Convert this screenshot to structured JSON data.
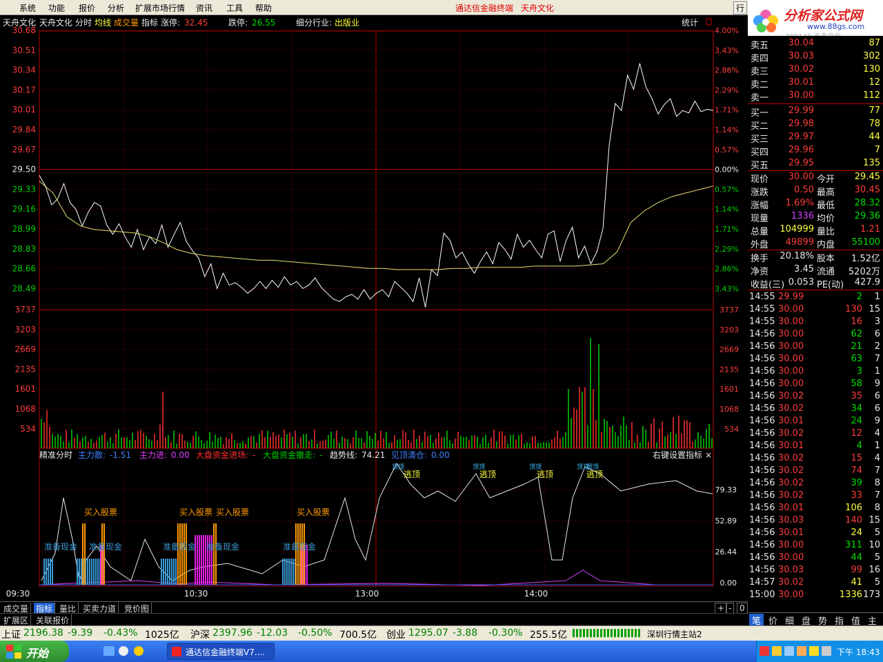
{
  "menu": {
    "items": [
      "系统",
      "功能",
      "报价",
      "分析",
      "扩展市场行情",
      "资讯",
      "工具",
      "帮助"
    ],
    "title1": "通达信金融终端",
    "title2": "天舟文化",
    "right_btn": "行"
  },
  "logo": {
    "text": "分析家公式网",
    "url": "www.88gs.com",
    "sub": "300148 天舟文化"
  },
  "chart_header": {
    "name": "天舟文化",
    "tabs": [
      "分时",
      "均线",
      "成交量",
      "指标"
    ],
    "zt_label": "涨停:",
    "zt_val": "32.45",
    "dt_label": "跌停:",
    "dt_val": "26.55",
    "ind_label": "细分行业:",
    "ind_val": "出版业",
    "stat": "统计"
  },
  "chart_data": [
    {
      "type": "line",
      "title": "天舟文化 分时",
      "prev_close": 29.5,
      "yticks_left": [
        "30.68",
        "30.51",
        "30.34",
        "30.17",
        "30.01",
        "29.84",
        "29.67",
        "29.50",
        "29.33",
        "29.16",
        "28.99",
        "28.83",
        "28.66",
        "28.49"
      ],
      "yticks_right": [
        "4.00%",
        "3.43%",
        "2.86%",
        "2.29%",
        "1.71%",
        "1.14%",
        "0.57%",
        "0.00%",
        "0.57%",
        "1.14%",
        "1.71%",
        "2.29%",
        "2.86%",
        "3.43%"
      ],
      "ylim": [
        28.38,
        30.68
      ],
      "xticks": [
        "09:30",
        "10:30",
        "13:00",
        "14:00"
      ],
      "series": [
        {
          "name": "价格",
          "values": [
            29.45,
            29.36,
            29.2,
            29.25,
            29.38,
            29.22,
            29.16,
            29.02,
            29.14,
            29.22,
            29.19,
            29.03,
            28.95,
            29.04,
            28.93,
            28.84,
            28.99,
            28.82,
            28.93,
            28.87,
            29.03,
            28.84,
            28.95,
            29.05,
            28.89,
            28.81,
            28.75,
            28.59,
            28.7,
            28.49,
            28.62,
            28.52,
            28.54,
            28.5,
            28.45,
            28.49,
            28.55,
            28.49,
            28.56,
            28.5,
            28.59,
            28.52,
            28.55,
            28.49,
            28.52,
            28.58,
            28.5,
            28.45,
            28.4,
            28.38,
            28.42,
            28.44,
            28.4,
            28.48,
            28.4,
            28.45,
            28.48,
            28.42,
            28.55,
            28.5,
            28.45,
            28.38,
            28.58,
            28.33,
            28.65,
            28.6,
            28.96,
            28.9,
            28.75,
            28.8,
            28.7,
            28.62,
            28.72,
            28.8,
            28.7,
            28.88,
            28.82,
            28.74,
            28.95,
            28.84,
            28.9,
            28.82,
            28.75,
            28.95,
            28.98,
            28.72,
            28.9,
            29.01,
            28.75,
            28.85,
            28.7,
            28.8,
            29.0,
            29.7,
            30.06,
            30.0,
            30.3,
            30.18,
            30.4,
            30.2,
            30.1,
            29.97,
            30.05,
            30.1,
            29.95,
            30.0,
            29.98,
            30.08,
            29.99,
            30.01,
            30.0
          ]
        },
        {
          "name": "均线",
          "values": [
            29.4,
            29.3,
            29.1,
            29.02,
            28.99,
            28.98,
            28.97,
            28.96,
            28.93,
            28.88,
            28.82,
            28.79,
            28.77,
            28.76,
            28.75,
            28.74,
            28.73,
            28.73,
            28.72,
            28.71,
            28.7,
            28.69,
            28.68,
            28.67,
            28.66,
            28.66,
            28.65,
            28.65,
            28.65,
            28.65,
            28.66,
            28.66,
            28.67,
            28.67,
            28.67,
            28.67,
            28.68,
            28.68,
            28.68,
            28.68,
            28.69,
            28.7,
            28.8,
            29.05,
            29.15,
            29.22,
            29.27,
            29.3,
            29.33,
            29.36
          ]
        }
      ]
    },
    {
      "type": "bar",
      "title": "成交量",
      "yticks": [
        "3737",
        "3203",
        "2669",
        "2135",
        "1601",
        "1068",
        "534"
      ],
      "ylim": [
        0,
        3737
      ]
    },
    {
      "type": "line",
      "title": "精准分时",
      "yticks": [
        "79.33",
        "52.89",
        "26.44",
        "0.00"
      ],
      "ylim": [
        0,
        100
      ],
      "legend": [
        {
          "name": "主力散:",
          "val": "-1.51"
        },
        {
          "name": "主力进:",
          "val": "0.00"
        },
        {
          "name": "大盘资金进场:",
          "val": "-"
        },
        {
          "name": "大盘资金撤走:",
          "val": "-"
        },
        {
          "name": "趋势线:",
          "val": "74.21"
        },
        {
          "name": "见顶清仓:",
          "val": "0.00"
        }
      ],
      "right_label": "右键设置指标",
      "close": "×",
      "annotations": {
        "buy": "买入股票",
        "cash": "准备现金",
        "top": "逃顶",
        "mark": "顶顶"
      }
    }
  ],
  "orderbook": {
    "sell": [
      [
        "卖五",
        "30.04",
        "87"
      ],
      [
        "卖四",
        "30.03",
        "302"
      ],
      [
        "卖三",
        "30.02",
        "130"
      ],
      [
        "卖二",
        "30.01",
        "12"
      ],
      [
        "卖一",
        "30.00",
        "112"
      ]
    ],
    "buy": [
      [
        "买一",
        "29.99",
        "77"
      ],
      [
        "买二",
        "29.98",
        "78"
      ],
      [
        "买三",
        "29.97",
        "44"
      ],
      [
        "买四",
        "29.96",
        "7"
      ],
      [
        "买五",
        "29.95",
        "135"
      ]
    ]
  },
  "quote": [
    [
      "现价",
      "30.00",
      "今开",
      "29.45"
    ],
    [
      "涨跌",
      "0.50",
      "最高",
      "30.45"
    ],
    [
      "涨幅",
      "1.69%",
      "最低",
      "28.32"
    ],
    [
      "现量",
      "1336",
      "均价",
      "29.36"
    ],
    [
      "总量",
      "104999",
      "量比",
      "1.21"
    ],
    [
      "外盘",
      "49899",
      "内盘",
      "55100"
    ]
  ],
  "finance": [
    [
      "换手",
      "20.18%",
      "股本",
      "1.52亿"
    ],
    [
      "净资",
      "3.45",
      "流通",
      "5202万"
    ],
    [
      "收益(三)",
      "0.053",
      "PE(动)",
      "427.9"
    ]
  ],
  "ticks": [
    [
      "14:55",
      "29.99",
      "2",
      "1",
      "g"
    ],
    [
      "14:55",
      "30.00",
      "130",
      "15",
      "r"
    ],
    [
      "14:55",
      "30.00",
      "16",
      "3",
      "r"
    ],
    [
      "14:56",
      "30.00",
      "62",
      "6",
      "g"
    ],
    [
      "14:56",
      "30.00",
      "21",
      "2",
      "g"
    ],
    [
      "14:56",
      "30.00",
      "63",
      "7",
      "g"
    ],
    [
      "14:56",
      "30.00",
      "3",
      "1",
      "g"
    ],
    [
      "14:56",
      "30.00",
      "58",
      "9",
      "g"
    ],
    [
      "14:56",
      "30.02",
      "35",
      "6",
      "r"
    ],
    [
      "14:56",
      "30.02",
      "34",
      "6",
      "g"
    ],
    [
      "14:56",
      "30.01",
      "24",
      "9",
      "g"
    ],
    [
      "14:56",
      "30.02",
      "12",
      "4",
      "r"
    ],
    [
      "14:56",
      "30.01",
      "4",
      "1",
      "g"
    ],
    [
      "14:56",
      "30.02",
      "15",
      "4",
      "r"
    ],
    [
      "14:56",
      "30.02",
      "74",
      "7",
      "r"
    ],
    [
      "14:56",
      "30.02",
      "39",
      "8",
      "g"
    ],
    [
      "14:56",
      "30.02",
      "33",
      "7",
      "r"
    ],
    [
      "14:56",
      "30.01",
      "106",
      "8",
      "y"
    ],
    [
      "14:56",
      "30.03",
      "140",
      "15",
      "r"
    ],
    [
      "14:56",
      "30.01",
      "24",
      "5",
      "y"
    ],
    [
      "14:56",
      "30.00",
      "311",
      "10",
      "g"
    ],
    [
      "14:56",
      "30.00",
      "44",
      "5",
      "g"
    ],
    [
      "14:56",
      "30.03",
      "99",
      "16",
      "r"
    ],
    [
      "14:57",
      "30.02",
      "41",
      "5",
      "y"
    ],
    [
      "15:00",
      "30.00",
      "1336",
      "173",
      "y"
    ]
  ],
  "right_tabs": [
    "笔",
    "价",
    "细",
    "盘",
    "势",
    "指",
    "值",
    "主"
  ],
  "bottom_tabs": [
    "成交量",
    "指标",
    "量比",
    "买卖力道",
    "竞价图"
  ],
  "bottom_tabs2": [
    "扩展区",
    "关联报价"
  ],
  "zoom": [
    "+",
    "-",
    "0"
  ],
  "status": [
    {
      "name": "上证",
      "val": "2196.38",
      "chg": "-9.39",
      "pct": "-0.43%",
      "amt": "1025亿"
    },
    {
      "name": "沪深",
      "val": "2397.96",
      "chg": "-12.03",
      "pct": "-0.50%",
      "amt": "700.5亿"
    },
    {
      "name": "创业",
      "val": "1295.07",
      "chg": "-3.88",
      "pct": "-0.30%",
      "amt": "255.5亿"
    }
  ],
  "server": "深圳行情主站2",
  "taskbar": {
    "start": "开始",
    "task": "通达信金融终端V7....",
    "time": "下午 18:43"
  }
}
